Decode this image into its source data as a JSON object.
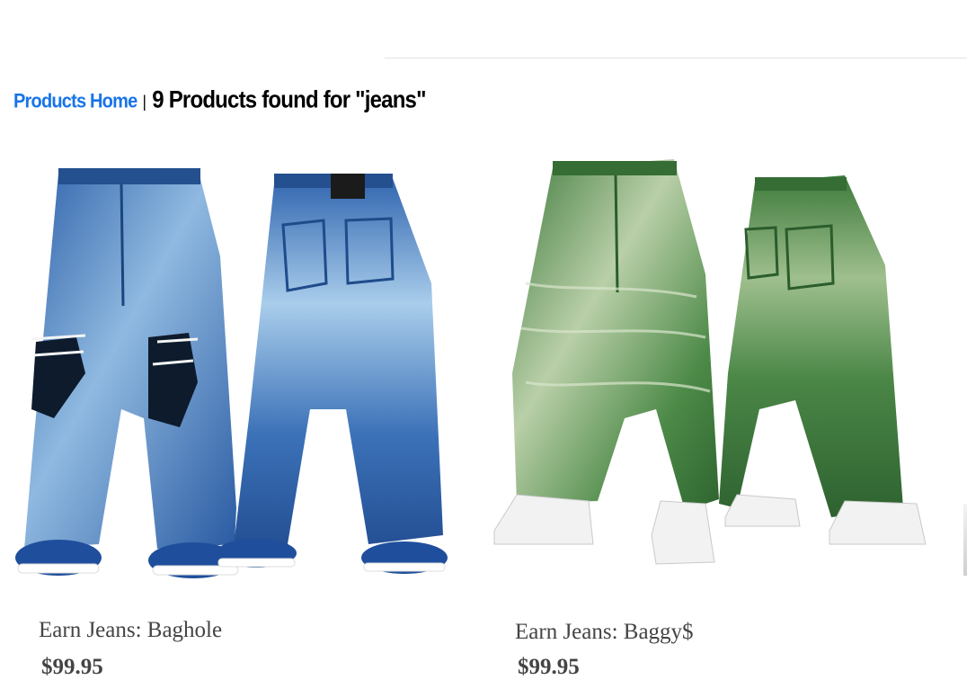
{
  "breadcrumb": {
    "home_link": "Products Home",
    "separator": "|",
    "result_text": "9 Products found for \"jeans\""
  },
  "products": [
    {
      "name": "Earn Jeans: Baghole",
      "price": "$99.95",
      "image_icon": "blue-distressed-baggy-jeans-image",
      "colors": {
        "denim": "#2c5fa8",
        "denim_light": "#9cc3e6",
        "shoe": "#1f4f9c"
      }
    },
    {
      "name": "Earn Jeans: Baggy$",
      "price": "$99.95",
      "image_icon": "green-washed-baggy-jeans-image",
      "colors": {
        "denim": "#3f7a3d",
        "denim_light": "#b9cfa8",
        "shoe": "#f1f1f1"
      }
    }
  ],
  "colors": {
    "link": "#1874e8",
    "text": "#000000",
    "muted": "#444444"
  }
}
